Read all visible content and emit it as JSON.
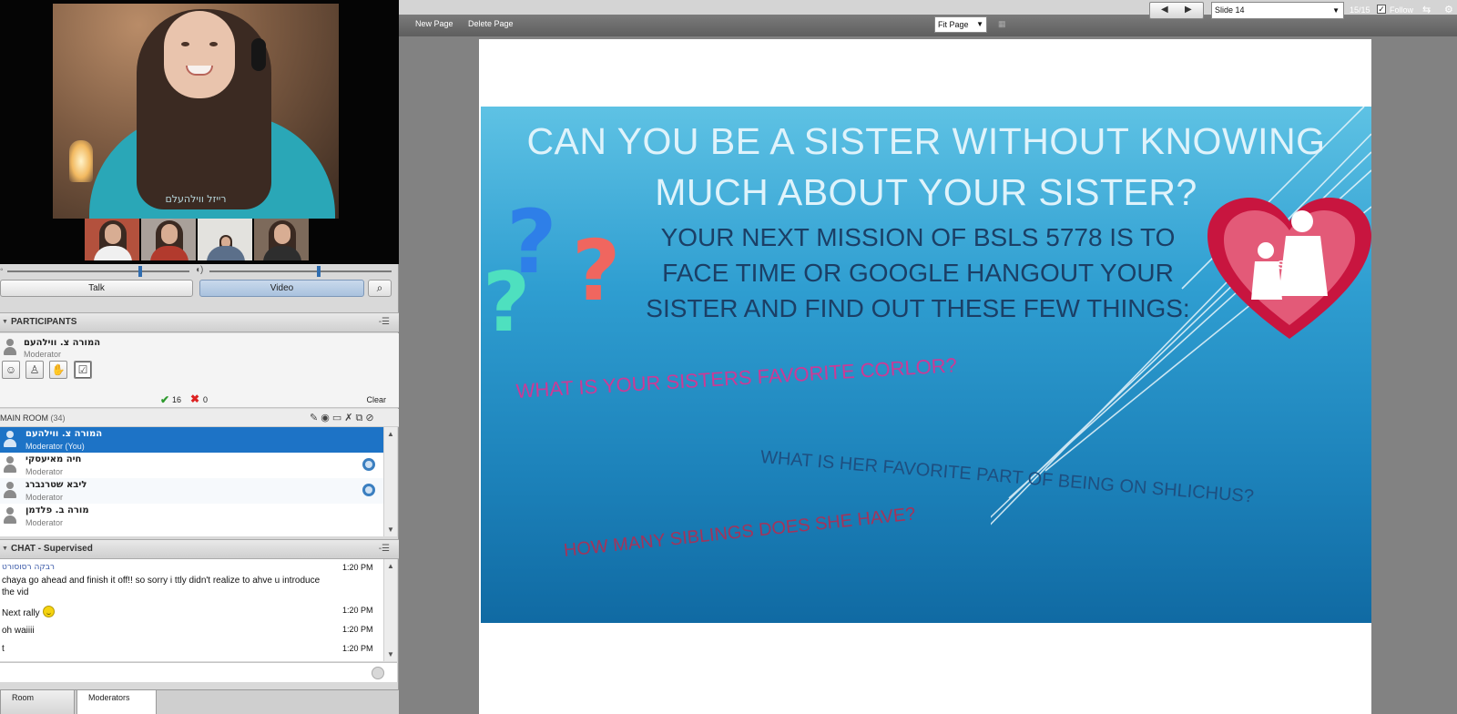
{
  "video": {
    "main_caption": "רייזל ווילהעלם",
    "participant_count_thumbs": 4
  },
  "controls": {
    "talk_label": "Talk",
    "video_label": "Video"
  },
  "participants": {
    "header": "PARTICIPANTS",
    "moderator_name": "המורה צ. ווילהעם",
    "moderator_role": "Moderator",
    "poll_yes": "16",
    "poll_no": "0",
    "clear_label": "Clear",
    "room_label": "MAIN ROOM",
    "room_count": "(34)",
    "list": [
      {
        "name": "המורה צ. ווילהעם",
        "role": "Moderator (You)",
        "selected": true,
        "camera": false
      },
      {
        "name": "חיה מאיעסקי",
        "role": "Moderator",
        "selected": false,
        "camera": true
      },
      {
        "name": "ליבא שטרנברג",
        "role": "Moderator",
        "selected": false,
        "camera": true
      },
      {
        "name": "מורה ב. פלדמן",
        "role": "Moderator",
        "selected": false,
        "camera": false
      }
    ]
  },
  "chat": {
    "header": "CHAT - Supervised",
    "sender": "רבקה רסוסורט",
    "messages": [
      {
        "text": "chaya go ahead and finish it off!! so sorry i ttly didn't realize to ahve u introduce",
        "time": "1:20 PM"
      },
      {
        "text": "the vid",
        "time": ""
      },
      {
        "text": "Next rally",
        "time": "1:20 PM"
      },
      {
        "text": "oh waiiii",
        "time": "1:20 PM"
      },
      {
        "text": "t",
        "time": "1:20 PM"
      }
    ],
    "tabs": [
      "Room",
      "Moderators"
    ]
  },
  "whiteboard": {
    "new_page": "New Page",
    "delete_page": "Delete Page",
    "fit_page": "Fit Page",
    "slide_selected": "Slide 14",
    "slide_count": "15/15",
    "follow_label": "Follow",
    "follow_checked": true
  },
  "slide": {
    "title_line1": "CAN YOU BE A SISTER WITHOUT KNOWING",
    "title_line2": "MUCH ABOUT YOUR SISTER?",
    "mission_line1": "YOUR NEXT MISSION OF BSLS 5778 IS TO",
    "mission_line2": "FACE TIME OR GOOGLE HANGOUT YOUR",
    "mission_line3": "SISTER AND FIND OUT THESE FEW THINGS:",
    "q1": "WHAT IS YOUR SISTERS FAVORITE CORLOR?",
    "q2": "WHAT IS HER FAVORITE PART OF  BEING ON SHLICHUS?",
    "q3": "HOW MANY SIBLINGS DOES SHE HAVE?",
    "logo_text": "Big Sister",
    "colors": {
      "accent_blue": "#1d73c6",
      "slide_top": "#5ec2e4",
      "slide_bottom": "#106aa3",
      "heart": "#c8153f",
      "q1_color": "#cc3a96",
      "q3_color": "#b22d52"
    }
  }
}
